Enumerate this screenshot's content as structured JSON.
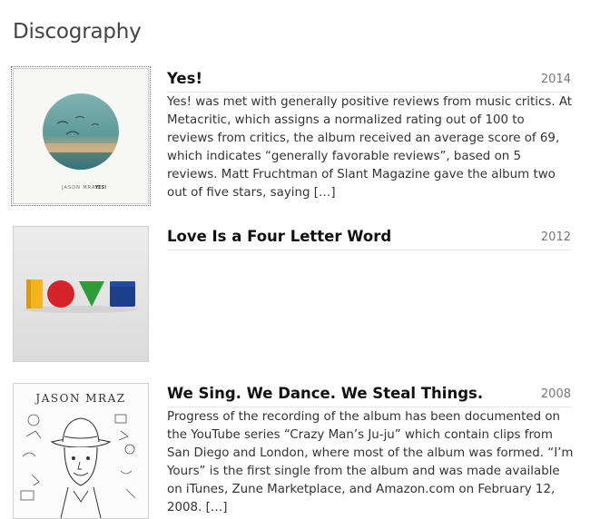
{
  "page": {
    "title": "Discography"
  },
  "albums": [
    {
      "title": "Yes!",
      "year": "2014",
      "cover_artist_text": "JASON MRAZ",
      "cover_album_text": "YES!",
      "description": "Yes! was met with generally positive reviews from music critics. At Metacritic, which assigns a normalized rating out of 100 to reviews from critics, the album received an average score of 69, which indicates “generally favorable reviews”, based on 5 reviews. Matt Fruchtman of Slant Magazine gave the album two out of five stars, saying […]"
    },
    {
      "title": "Love Is a Four Letter Word",
      "year": "2012",
      "description": ""
    },
    {
      "title": "We Sing. We Dance. We Steal Things.",
      "year": "2008",
      "cover_artist_text": "JASON MRAZ",
      "description": "Progress of the recording of the album has been documented on the YouTube series “Crazy Man’s Ju-ju” which contain clips from San Diego and London, where most of the album was formed. “I’m Yours” is the first single from the album and was made available on iTunes, Zune Marketplace, and Amazon.com on February 12, 2008. […]"
    }
  ]
}
